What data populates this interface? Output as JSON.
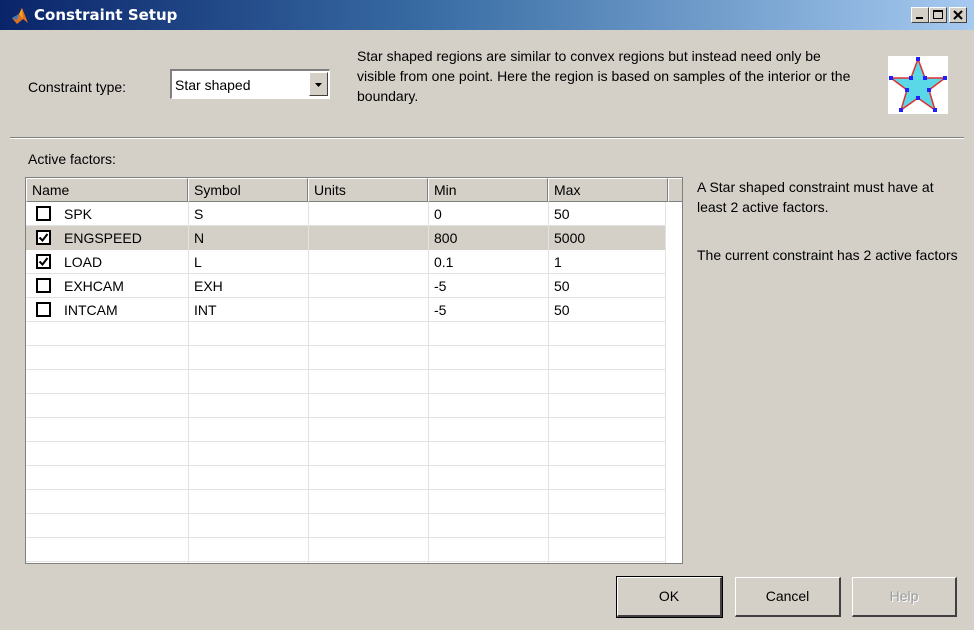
{
  "window": {
    "title": "Constraint Setup",
    "minimize_icon": "minimize-icon",
    "maximize_icon": "maximize-icon",
    "close_icon": "close-icon"
  },
  "constraint": {
    "type_label": "Constraint type:",
    "type_value": "Star shaped",
    "description": "Star shaped regions are similar to convex regions but instead need only be visible from one point. Here the region is based on samples of the interior or the boundary.",
    "preview_icon": "star-shape-icon"
  },
  "factors": {
    "label": "Active factors:",
    "columns": [
      "Name",
      "Symbol",
      "Units",
      "Min",
      "Max"
    ],
    "rows": [
      {
        "checked": false,
        "name": "SPK",
        "symbol": "S",
        "units": "",
        "min": "0",
        "max": "50"
      },
      {
        "checked": true,
        "name": "ENGSPEED",
        "symbol": "N",
        "units": "",
        "min": "800",
        "max": "5000"
      },
      {
        "checked": true,
        "name": "LOAD",
        "symbol": "L",
        "units": "",
        "min": "0.1",
        "max": "1"
      },
      {
        "checked": false,
        "name": "EXHCAM",
        "symbol": "EXH",
        "units": "",
        "min": "-5",
        "max": "50"
      },
      {
        "checked": false,
        "name": "INTCAM",
        "symbol": "INT",
        "units": "",
        "min": "-5",
        "max": "50"
      }
    ],
    "selected_row": 1
  },
  "info": {
    "requirement": "A Star shaped constraint must have at least 2 active factors.",
    "status": "The current constraint has 2 active factors"
  },
  "buttons": {
    "ok": "OK",
    "cancel": "Cancel",
    "help": "Help"
  },
  "colors": {
    "title_start": "#0a246a",
    "title_end": "#a6caf0",
    "face": "#d4d0c8",
    "star_fill": "#5ad8e8",
    "star_vertex": "#2020ff"
  }
}
